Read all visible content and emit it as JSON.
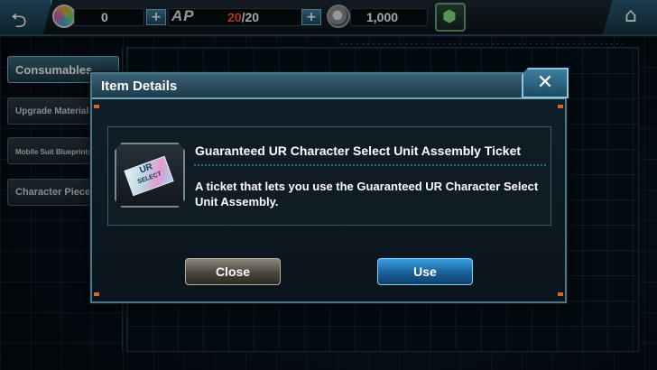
{
  "top_bar": {
    "back_icon": "back-arrow-icon",
    "gems_icon": "gem-currency-icon",
    "gems_value": "0",
    "gems_plus": "+",
    "ap_label": "AP",
    "ap_current": "20",
    "ap_separator": "/",
    "ap_max": "20",
    "ap_plus": "+",
    "coin_icon": "coin-currency-icon",
    "coins_value": "1,000",
    "event_icon": "event-badge-icon",
    "home_icon": "home-icon"
  },
  "sidebar": {
    "tabs": [
      {
        "label": "Consumables",
        "active": true
      },
      {
        "label": "Upgrade Materials",
        "active": false
      },
      {
        "label": "Mobile Suit Blueprints",
        "active": false
      },
      {
        "label": "Character Pieces",
        "active": false
      }
    ]
  },
  "modal": {
    "title": "Item Details",
    "close_symbol": "✕",
    "item": {
      "thumbnail_icon": "ticket-icon",
      "ticket_text_top": "UR",
      "ticket_text_bottom": "SELECT",
      "name": "Guaranteed UR Character Select Unit Assembly Ticket",
      "description": "A ticket that lets you use the Guaranteed UR Character Select Unit Assembly."
    },
    "buttons": {
      "close_label": "Close",
      "use_label": "Use"
    }
  },
  "colors": {
    "ap_current": "#ff5a3c",
    "accent": "#4a7688",
    "use_button": "#1a5e9a",
    "close_button": "#4a463d"
  }
}
